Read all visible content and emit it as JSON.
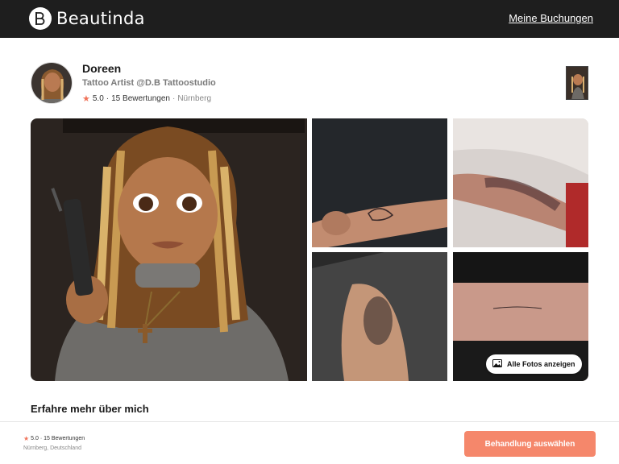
{
  "header": {
    "brand": "Beautinda",
    "brand_mark_letter": "B",
    "nav_bookings": "Meine Buchungen"
  },
  "profile": {
    "name": "Doreen",
    "role": "Tattoo Artist @D.B Tattoostudio",
    "rating": "5.0",
    "reviews": "15 Bewertungen",
    "separator": "·",
    "city": "Nürnberg"
  },
  "gallery": {
    "all_photos_label": "Alle Fotos anzeigen",
    "tile_count": 5
  },
  "section": {
    "title": "Erfahre mehr über mich"
  },
  "footer": {
    "rating_text": "5.0 · 15 Bewertungen",
    "location": "Nürnberg, Deutschland",
    "cta_label": "Behandlung auswählen"
  },
  "colors": {
    "header_bg": "#1e1e1e",
    "accent": "#f5876b",
    "star": "#f0735a"
  },
  "icons": [
    "brand-logo-icon",
    "star-icon",
    "image-icon"
  ]
}
